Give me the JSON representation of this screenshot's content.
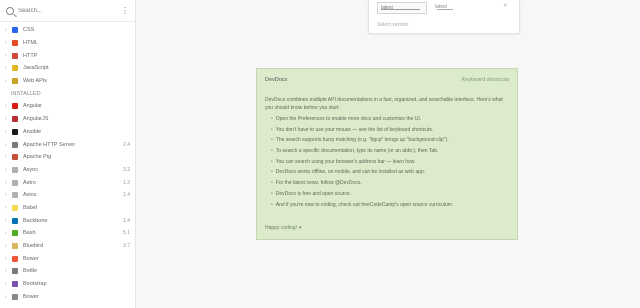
{
  "sidebar": {
    "search": {
      "placeholder": "Search..."
    },
    "items": [
      {
        "label": "CSS",
        "version": "",
        "color": "#2965f1",
        "section": false
      },
      {
        "label": "HTML",
        "version": "",
        "color": "#e34c26",
        "section": false
      },
      {
        "label": "HTTP",
        "version": "",
        "color": "#d04b3b",
        "section": false
      },
      {
        "label": "JavaScript",
        "version": "",
        "color": "#e0b825",
        "section": false
      },
      {
        "label": "Web APIs",
        "version": "",
        "color": "#c8a12a",
        "section": false
      },
      {
        "label": "INSTALLED",
        "version": "",
        "color": "#ffffff",
        "section": true
      },
      {
        "label": "Angular",
        "version": "",
        "color": "#dd1b16",
        "section": false
      },
      {
        "label": "AngularJS",
        "version": "",
        "color": "#b52e31",
        "section": false
      },
      {
        "label": "Ansible",
        "version": "",
        "color": "#1a1918",
        "section": false
      },
      {
        "label": "Apache HTTP Server",
        "version": "2.4",
        "color": "#7a7a7a",
        "section": false
      },
      {
        "label": "Apache Pig",
        "version": "",
        "color": "#c94f3a",
        "section": false
      },
      {
        "label": "Async",
        "version": "3.2",
        "color": "#b0b0b0",
        "section": false
      },
      {
        "label": "Astro",
        "version": "1.2",
        "color": "#b0b0b0",
        "section": false
      },
      {
        "label": "Axios",
        "version": "1.4",
        "color": "#b0b0b0",
        "section": false
      },
      {
        "label": "Babel",
        "version": "",
        "color": "#f5da55",
        "section": false
      },
      {
        "label": "Backbone",
        "version": "1.4",
        "color": "#0071b5",
        "section": false
      },
      {
        "label": "Bash",
        "version": "5.1",
        "color": "#4eaa25",
        "section": false
      },
      {
        "label": "Bluebird",
        "version": "3.7",
        "color": "#d9b45a",
        "section": false
      },
      {
        "label": "Bower",
        "version": "",
        "color": "#ef5734",
        "section": false
      },
      {
        "label": "Bottle",
        "version": "",
        "color": "#7a7a7a",
        "section": false
      },
      {
        "label": "Bootstrap",
        "version": "",
        "color": "#7952b3",
        "section": false
      },
      {
        "label": "Bower",
        "version": "",
        "color": "#888888",
        "section": false
      }
    ]
  },
  "version_picker": {
    "selected": "latest",
    "option": "latest",
    "close": "×",
    "caption": "Select version"
  },
  "welcome": {
    "title": "DevDocs",
    "link": "Keyboard shortcuts",
    "intro": "DevDocs combines multiple API documentations in a fast, organized, and searchable interface. Here's what you should know before you start:",
    "items": [
      "Open the Preferences to enable more docs and customize the UI.",
      "You don't have to use your mouse — see the list of keyboard shortcuts.",
      "The search supports fuzzy matching (e.g. \"bgcp\" brings up \"background-clip\").",
      "To search a specific documentation, type its name (or an abbr.), then Tab.",
      "You can search using your browser's address bar — learn how.",
      "DevDocs works offline, on mobile, and can be installed as web app.",
      "For the latest news, follow @DevDocs.",
      "DevDocs is free and open source.",
      "And if you're new to coding, check out freeCodeCamp's open source curriculum."
    ],
    "footer": "Happy coding!"
  }
}
